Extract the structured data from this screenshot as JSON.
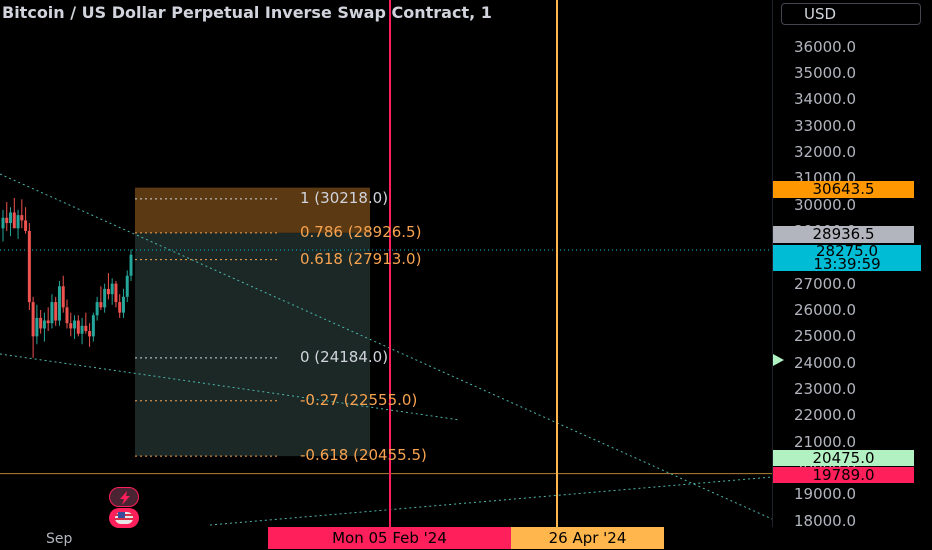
{
  "header": {
    "title": "Bitcoin / US Dollar Perpetual Inverse Swap Contract, 1",
    "currency": "USD"
  },
  "price_axis": {
    "ticks": [
      "36000.0",
      "35000.0",
      "34000.0",
      "33000.0",
      "32000.0",
      "31000.0",
      "30000.0",
      "29000.0",
      "28000.0",
      "27000.0",
      "26000.0",
      "25000.0",
      "24000.0",
      "23000.0",
      "22000.0",
      "21000.0",
      "20000.0",
      "19000.0",
      "18000.0"
    ]
  },
  "price_badges": {
    "fib_top": "30643.5",
    "crosshair": "28936.5",
    "last_price": "28275.0",
    "countdown": "13:39:59",
    "level_low": "20475.0",
    "level_bottom": "19789.0"
  },
  "fib_levels": [
    {
      "label": "1 (30218.0)",
      "price": 30218.0,
      "color": "#d1d4dc"
    },
    {
      "label": "0.786 (28926.5)",
      "price": 28926.5,
      "color": "#f7a350"
    },
    {
      "label": "0.618 (27913.0)",
      "price": 27913.0,
      "color": "#f7a350"
    },
    {
      "label": "0 (24184.0)",
      "price": 24184.0,
      "color": "#d1d4dc"
    },
    {
      "label": "-0.27 (22555.0)",
      "price": 22555.0,
      "color": "#f7a350"
    },
    {
      "label": "-0.618 (20455.5)",
      "price": 20455.5,
      "color": "#f7a350"
    }
  ],
  "time_axis": {
    "month_label": "Sep",
    "cursor_date": "Mon 05 Feb '24",
    "marker_date": "26 Apr '24"
  },
  "colors": {
    "red_line": "#ff1f5a",
    "orange_line": "#ffb74d",
    "fib_box_top": "#6b4315",
    "fib_box_main": "#1e2c2a",
    "up": "#26a69a",
    "down": "#ef5350",
    "last_price_bg": "#00bcd4",
    "trend": "#4db6ac"
  },
  "candles": [
    {
      "o": 29100,
      "h": 29800,
      "l": 28600,
      "c": 29500
    },
    {
      "o": 29500,
      "h": 30100,
      "l": 29000,
      "c": 29300
    },
    {
      "o": 29300,
      "h": 29900,
      "l": 28800,
      "c": 29700
    },
    {
      "o": 29700,
      "h": 30250,
      "l": 29200,
      "c": 29100
    },
    {
      "o": 29100,
      "h": 29800,
      "l": 28700,
      "c": 29600
    },
    {
      "o": 29600,
      "h": 30200,
      "l": 29100,
      "c": 29400
    },
    {
      "o": 29400,
      "h": 29900,
      "l": 28900,
      "c": 29000
    },
    {
      "o": 29000,
      "h": 29300,
      "l": 26000,
      "c": 26300
    },
    {
      "o": 26300,
      "h": 26500,
      "l": 24184,
      "c": 25000
    },
    {
      "o": 25000,
      "h": 26200,
      "l": 24700,
      "c": 25700
    },
    {
      "o": 25700,
      "h": 26000,
      "l": 25100,
      "c": 25300
    },
    {
      "o": 25300,
      "h": 25900,
      "l": 24800,
      "c": 25600
    },
    {
      "o": 25600,
      "h": 26100,
      "l": 25200,
      "c": 25500
    },
    {
      "o": 25500,
      "h": 26600,
      "l": 25300,
      "c": 26300
    },
    {
      "o": 26300,
      "h": 26500,
      "l": 25400,
      "c": 25600
    },
    {
      "o": 25600,
      "h": 27100,
      "l": 25400,
      "c": 26900
    },
    {
      "o": 26900,
      "h": 27300,
      "l": 25900,
      "c": 26100
    },
    {
      "o": 26100,
      "h": 26400,
      "l": 25300,
      "c": 25500
    },
    {
      "o": 25500,
      "h": 25900,
      "l": 25000,
      "c": 25300
    },
    {
      "o": 25300,
      "h": 25800,
      "l": 24900,
      "c": 25600
    },
    {
      "o": 25600,
      "h": 25800,
      "l": 25000,
      "c": 25100
    },
    {
      "o": 25100,
      "h": 25700,
      "l": 24700,
      "c": 25400
    },
    {
      "o": 25400,
      "h": 25900,
      "l": 25100,
      "c": 25200
    },
    {
      "o": 25200,
      "h": 25500,
      "l": 24600,
      "c": 25000
    },
    {
      "o": 25000,
      "h": 25900,
      "l": 24800,
      "c": 25800
    },
    {
      "o": 25800,
      "h": 26500,
      "l": 25600,
      "c": 26300
    },
    {
      "o": 26300,
      "h": 26900,
      "l": 26000,
      "c": 26100
    },
    {
      "o": 26100,
      "h": 27000,
      "l": 25900,
      "c": 26800
    },
    {
      "o": 26800,
      "h": 27400,
      "l": 26400,
      "c": 26600
    },
    {
      "o": 26600,
      "h": 27200,
      "l": 26200,
      "c": 27000
    },
    {
      "o": 27000,
      "h": 27100,
      "l": 26100,
      "c": 26300
    },
    {
      "o": 26300,
      "h": 26600,
      "l": 25700,
      "c": 25900
    },
    {
      "o": 25900,
      "h": 26800,
      "l": 25700,
      "c": 26500
    },
    {
      "o": 26500,
      "h": 27500,
      "l": 26300,
      "c": 27300
    },
    {
      "o": 27300,
      "h": 28300,
      "l": 27100,
      "c": 28100
    }
  ]
}
